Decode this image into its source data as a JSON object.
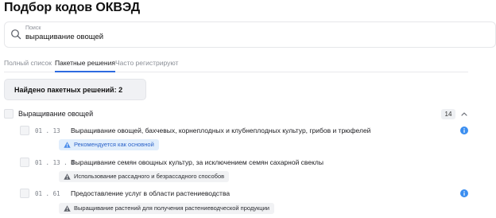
{
  "header": {
    "title": "Подбор кодов ОКВЭД"
  },
  "search": {
    "label": "Поиск",
    "value": "выращивание овощей"
  },
  "tabs": [
    {
      "label": "Полный список",
      "active": false
    },
    {
      "label": "Пакетные решения",
      "active": true
    },
    {
      "label": "Часто регистрируют",
      "active": false
    }
  ],
  "found": {
    "text": "Найдено пакетных решений: 2"
  },
  "group": {
    "label": "Выращивание овощей",
    "count": "14",
    "items": [
      {
        "code": "01.13",
        "title": "Выращивание овощей, бахчевых, корнеплодных и клубнеплодных культур, грибов и трюфелей",
        "tag": "Рекомендуется как основной",
        "tag_style": "blue",
        "tag_icon": "warning-icon",
        "has_info": true
      },
      {
        "code": "01.13.4",
        "title": "Выращивание семян овощных культур, за исключением семян сахарной свеклы",
        "tag": "Использование рассадного и безрассадного способов",
        "tag_style": "gray",
        "tag_icon": "warning-icon",
        "has_info": false
      },
      {
        "code": "01.61",
        "title": "Предоставление услуг в области растениеводства",
        "tag": "Выращивание растений для получения растениеводческой продукции",
        "tag_style": "gray",
        "tag_icon": "warning-icon",
        "has_info": true
      }
    ]
  },
  "colors": {
    "accent": "#2d6be0",
    "info": "#3b8ef0",
    "blue_tag_bg": "#e1eefc"
  }
}
